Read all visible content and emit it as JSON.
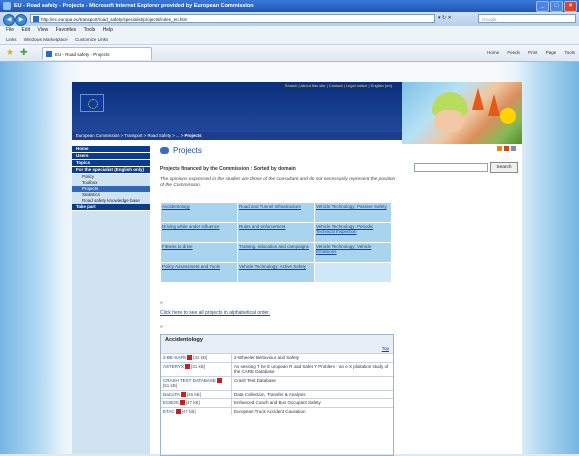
{
  "window": {
    "title": "EU - Road safety - Projects - Microsoft Internet Explorer provided by European Commission"
  },
  "browser": {
    "address": "http://ec.europa.eu/transport/road_safety/specialist/projects/index_en.htm",
    "search_placeholder": "Google",
    "menu": [
      "File",
      "Edit",
      "View",
      "Favorites",
      "Tools",
      "Help"
    ],
    "links": [
      "Links",
      "Windows Marketplace",
      "Customize Links"
    ],
    "tab": "EU - Road safety - Projects",
    "tools": [
      "Home",
      "Feeds",
      "Print",
      "Page",
      "Tools"
    ]
  },
  "site": {
    "top_links": "Search | About this site | Contact | Legal notice | English (en)",
    "breadcrumb": [
      "European Commission",
      "Transport",
      "Road Safety",
      "...",
      "Projects"
    ]
  },
  "sidebar": [
    {
      "label": "Home",
      "type": "head"
    },
    {
      "label": "Users",
      "type": "head"
    },
    {
      "label": "Topics",
      "type": "head"
    },
    {
      "label": "For the specialist (English only)",
      "type": "head"
    },
    {
      "label": "Policy",
      "type": "sub"
    },
    {
      "label": "Toolbox",
      "type": "sub"
    },
    {
      "label": "Projects",
      "type": "sub",
      "active": true
    },
    {
      "label": "Statistics",
      "type": "sub"
    },
    {
      "label": "Road safety knowledge base",
      "type": "sub"
    },
    {
      "label": "Take part",
      "type": "head"
    }
  ],
  "main": {
    "title": "Projects",
    "subtitle": "Projects financed by the Commission : Sorted by domain",
    "note": "The opinions expressed in the studies are those of the consultant and do not necessarily represent the position of the Commission.",
    "domains": [
      [
        "Accidentology",
        "Road and Tunnel Infrastructure",
        "Vehicle Technology: Passive Safety"
      ],
      [
        "Driving while under influence",
        "Rules and enforcement",
        "Vehicle Technology: Periodic Technical Inspection"
      ],
      [
        "Fitness to drive",
        "Training, education and campaigns",
        "Vehicle Technology: Vehicle Emissions"
      ],
      [
        "Policy Assessment and Tools",
        "Vehicle Technology: Active Safety",
        ""
      ]
    ],
    "alpha_link": "Click here to see all projects in alphabetical order.",
    "accidentology": {
      "title": "Accidentology",
      "top": "Top",
      "rows": [
        {
          "name": "2-BE-SAFE",
          "size": "[32 kB]",
          "desc": "2-Wheeler Behaviour and Safety"
        },
        {
          "name": "ASTERYX",
          "size": "[31 kB]",
          "desc": "As sessing T he E uropean R oad Safet Y Problem - an e X ploitation study of the CARE Database"
        },
        {
          "name": "CRASH TEST DATABASE",
          "size": "[51 kB]",
          "desc": "Crash Test Database"
        },
        {
          "name": "DaCoTA",
          "size": "[46 kB]",
          "desc": "Data Collection, Transfer & Analysis"
        },
        {
          "name": "ECBOS",
          "size": "[47 kB]",
          "desc": "Enhanced Coach and Bus Occupant Safety"
        },
        {
          "name": "ETAC",
          "size": "[47 kB]",
          "desc": "European Truck Accident Causation"
        }
      ]
    }
  },
  "right": {
    "search_button": "Search"
  },
  "colors": {
    "accent": "#0a2f7c",
    "link": "#15479b",
    "domain_cell": "#a9d4ef"
  }
}
